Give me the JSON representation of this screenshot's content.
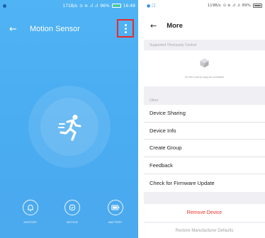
{
  "left": {
    "status": {
      "speed": "171B/s",
      "battery_pct": "96%",
      "time": "16:49"
    },
    "title": "Motion Sensor",
    "icons": {
      "back": "back-arrow-icon",
      "menu": "more-vertical-icon",
      "center": "running-person-icon"
    },
    "actions": [
      {
        "label": "HISTORY",
        "icon": "bell-icon"
      },
      {
        "label": "NOTICE",
        "icon": "notice-icon"
      },
      {
        "label": "BATTERY",
        "icon": "battery-icon"
      }
    ],
    "colors": {
      "background": "#4aacf1",
      "highlight_box": "#e82b2b"
    }
  },
  "right": {
    "status": {
      "speed": "119B/s",
      "battery_pct": "89%"
    },
    "title": "More",
    "sections": {
      "third_party": "Supported Third-party Control",
      "third_party_empty": "No third party support available",
      "other": "Other"
    },
    "menu_items": [
      "Device Sharing",
      "Device Info",
      "Create Group",
      "Feedback",
      "Check for Firmware Update"
    ],
    "remove_device": "Remove Device",
    "restore_defaults": "Restore Manufacturer Defaults",
    "colors": {
      "remove": "#e8352b",
      "muted": "#a0a0a0"
    }
  }
}
